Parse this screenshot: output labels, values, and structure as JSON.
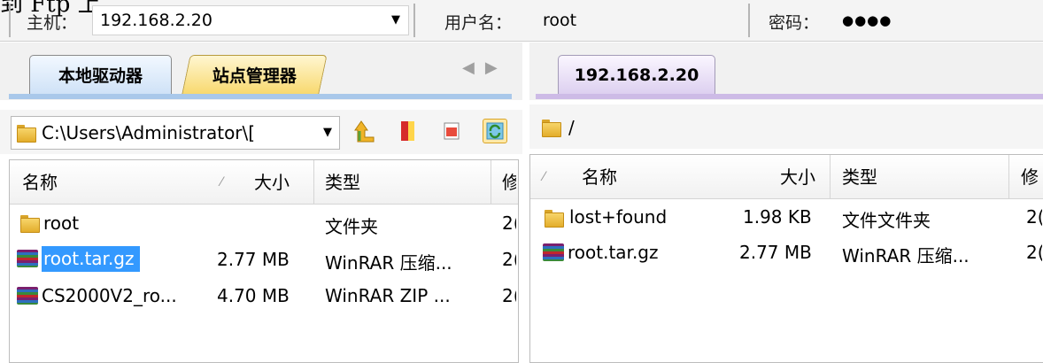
{
  "caption_fragment": "到 Ftp 上",
  "connection": {
    "host_label": "主机：",
    "host_value": "192.168.2.20",
    "user_label": "用户名：",
    "user_value": "root",
    "password_label": "密码：",
    "password_mask": "●●●●"
  },
  "tabs": {
    "local": "本地驱动器",
    "site": "站点管理器",
    "remote": "192.168.2.20"
  },
  "local": {
    "path": "C:\\Users\\Administrator\\[",
    "columns": {
      "name": "名称",
      "size": "大小",
      "type": "类型",
      "modified": "修"
    },
    "rows": [
      {
        "name": "root",
        "size": "",
        "type": "文件夹",
        "modified": "2(",
        "icon": "folder-icon"
      },
      {
        "name": "root.tar.gz",
        "size": "2.77 MB",
        "type": "WinRAR 压缩...",
        "modified": "2(",
        "icon": "winrar-archive-icon"
      },
      {
        "name": "CS2000V2_ro...",
        "size": "4.70 MB",
        "type": "WinRAR ZIP ...",
        "modified": "2(",
        "icon": "winrar-archive-icon"
      }
    ]
  },
  "remote": {
    "path": "/",
    "columns": {
      "name": "名称",
      "size": "大小",
      "type": "类型",
      "modified": "修"
    },
    "rows": [
      {
        "name": "lost+found",
        "size": "1.98 KB",
        "type": "文件文件夹",
        "modified": "2(",
        "icon": "folder-icon"
      },
      {
        "name": "root.tar.gz",
        "size": "2.77 MB",
        "type": "WinRAR 压缩...",
        "modified": "2(",
        "icon": "winrar-archive-icon"
      }
    ]
  },
  "colors": {
    "selection": "#3399ff",
    "local_tab": "#cfe2f7",
    "site_tab": "#f8d96f",
    "remote_tab": "#ddd0f0"
  }
}
